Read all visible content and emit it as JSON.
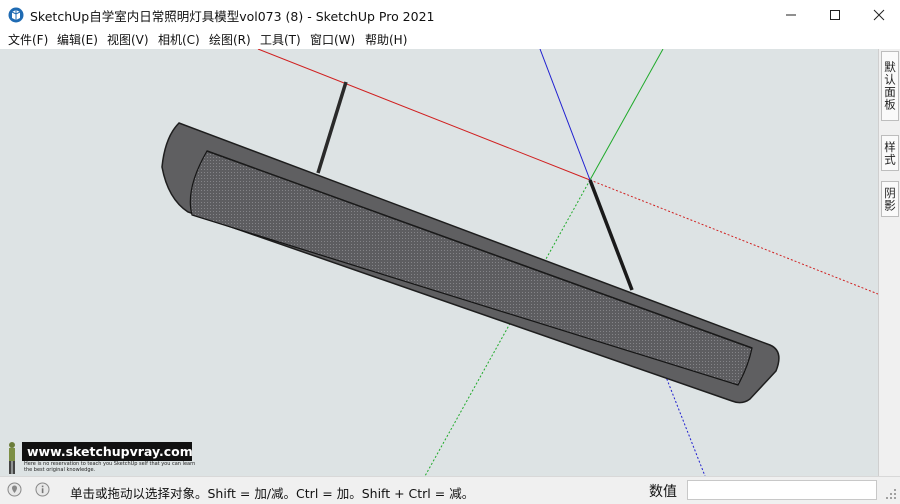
{
  "window": {
    "title": "SketchUp自学室内日常照明灯具模型vol073 (8) - SketchUp Pro 2021",
    "controls": {
      "minimize": "—",
      "maximize": "☐",
      "close": "✕"
    }
  },
  "menu": [
    {
      "label": "文件(F)"
    },
    {
      "label": "编辑(E)"
    },
    {
      "label": "视图(V)"
    },
    {
      "label": "相机(C)"
    },
    {
      "label": "绘图(R)"
    },
    {
      "label": "工具(T)"
    },
    {
      "label": "窗口(W)"
    },
    {
      "label": "帮助(H)"
    }
  ],
  "tray_tabs": [
    {
      "label": "默认面板"
    },
    {
      "label": "样式"
    },
    {
      "label": "阴影"
    }
  ],
  "watermark": {
    "site": "www.sketchupvray.com",
    "tagline": "Here is no reservation to teach you SketchUp self that you can learn the best original knowledge."
  },
  "status": {
    "hint": "单击或拖动以选择对象。Shift = 加/减。Ctrl = 加。Shift + Ctrl = 减。",
    "measurements_label": "数值",
    "measurements_value": ""
  },
  "icons": [
    "sketchup-app-icon",
    "geo-location-icon",
    "info-icon",
    "resize-grip-icon"
  ],
  "colors": {
    "viewport_bg": "#dde3e4",
    "axis_red": "#d02020",
    "axis_green": "#1faa2a",
    "axis_blue": "#2020d0",
    "fixture_body": "#5f5f61"
  }
}
